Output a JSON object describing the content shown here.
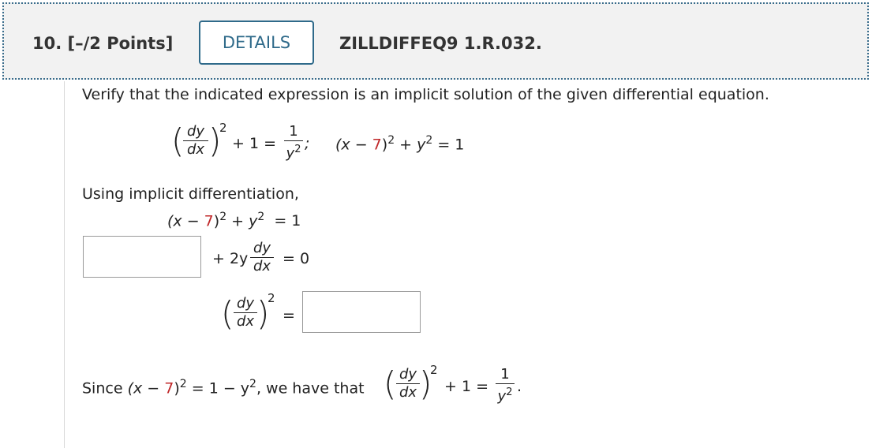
{
  "header": {
    "question_number": "10.",
    "points": "[–/2 Points]",
    "details_label": "DETAILS",
    "problem_code": "ZILLDIFFEQ9 1.R.032."
  },
  "problem": {
    "instruction": "Verify that the indicated expression is an implicit solution of the given differential equation.",
    "eq1": {
      "frac_num": "dy",
      "frac_den": "dx",
      "exp": "2",
      "plus_one": "+ 1 =",
      "rhs_num": "1",
      "rhs_den": "y",
      "rhs_den_exp": "2",
      "semicolon": ";"
    },
    "eq2": {
      "open": "(x −",
      "seven": "7",
      "close": ")",
      "exp1": "2",
      "plus_y": "+ y",
      "exp2": "2",
      "equals_one": "= 1"
    }
  },
  "work": {
    "intro": "Using implicit differentiation,",
    "line1": {
      "open": "(x −",
      "seven": "7",
      "close": ")",
      "exp1": "2",
      "plus_y": "+ y",
      "exp2": "2",
      "equals": "= 1"
    },
    "line2": {
      "plus_2y": "+ 2y",
      "frac_num": "dy",
      "frac_den": "dx",
      "equals": "= 0",
      "answer_value": ""
    },
    "line3": {
      "frac_num": "dy",
      "frac_den": "dx",
      "exp": "2",
      "equals": "=",
      "answer_value": ""
    }
  },
  "conclusion": {
    "since": "Since",
    "open": "(x −",
    "seven": "7",
    "close": ")",
    "exp1": "2",
    "middle": "= 1 − y",
    "exp2": "2",
    "we_have": ", we have that",
    "frac_num": "dy",
    "frac_den": "dx",
    "exp3": "2",
    "plus_one": "+ 1 =",
    "rhs_num": "1",
    "rhs_den": "y",
    "rhs_den_exp": "2",
    "period": "."
  }
}
